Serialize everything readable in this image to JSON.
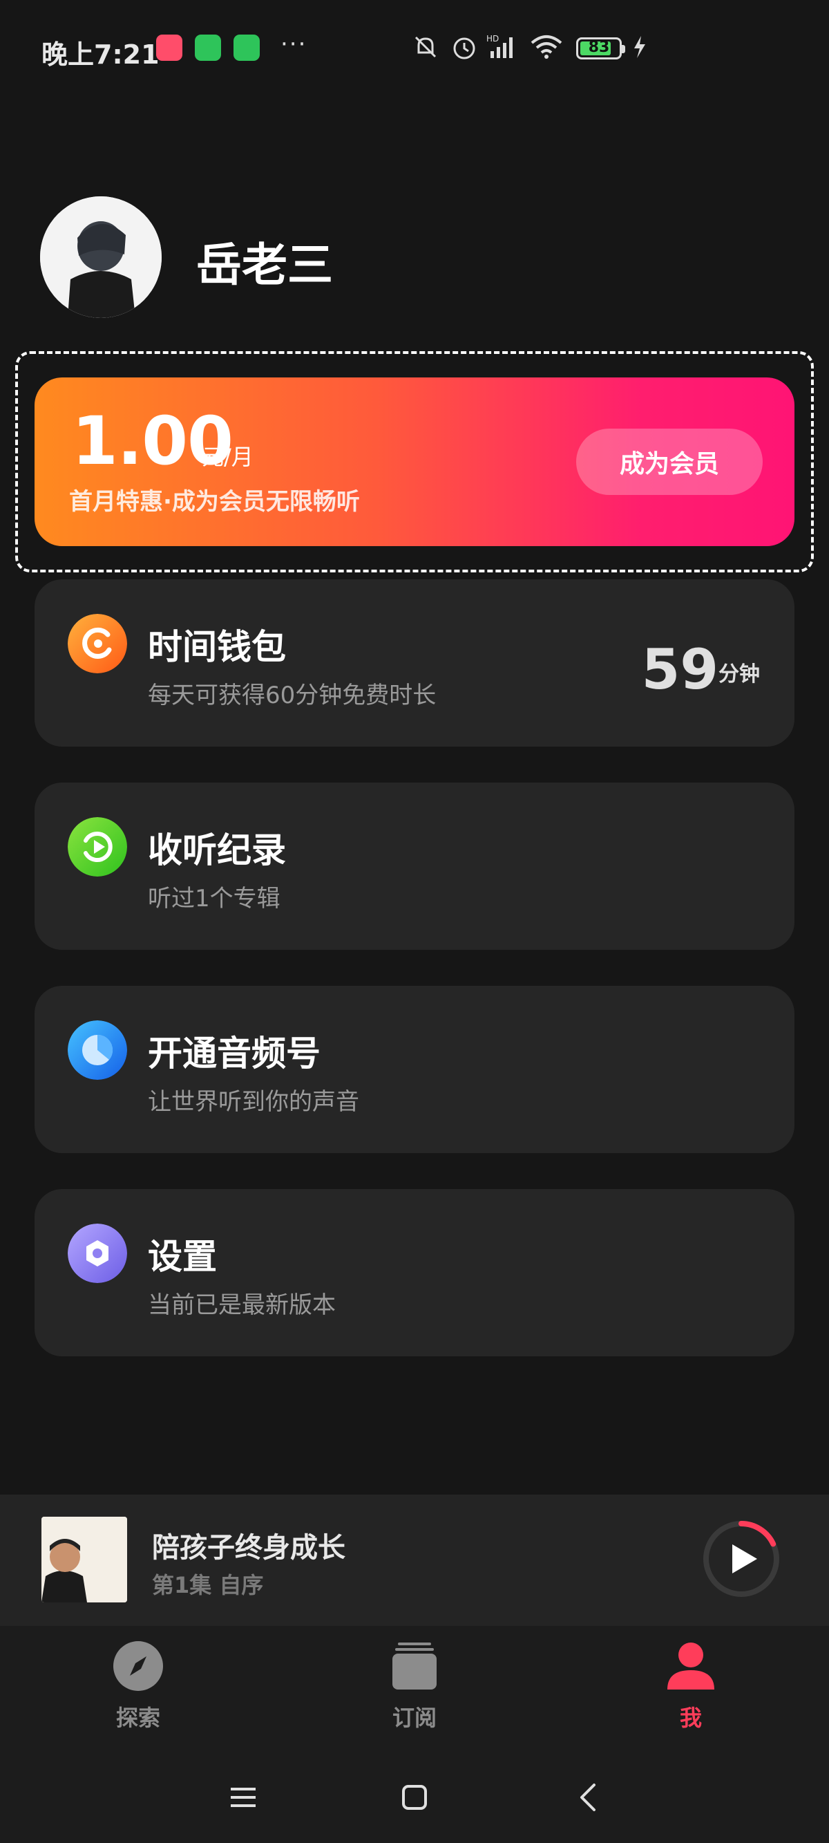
{
  "status_bar": {
    "time": "晚上7:21",
    "battery": "83",
    "battery_level": 0.83,
    "more": "···",
    "icons": [
      "app-notification-icon",
      "wechat-icon",
      "wechat-icon",
      "mute-icon",
      "alarm-icon",
      "signal-hd-icon",
      "wifi-icon",
      "battery-icon",
      "charging-icon"
    ]
  },
  "profile": {
    "username": "岳老三",
    "avatar_icon": "avatar-image"
  },
  "vip": {
    "price": "1.00",
    "unit": "元/月",
    "desc": "首月特惠·成为会员无限畅听",
    "button": "成为会员"
  },
  "menu": [
    {
      "title": "时间钱包",
      "subtitle": "每天可获得60分钟免费时长",
      "value": "59",
      "value_unit": "分钟",
      "icon": "time-wallet-icon",
      "color": "#ff8a1a"
    },
    {
      "title": "收听纪录",
      "subtitle": "听过1个专辑",
      "icon": "history-icon",
      "color": "#5fd42a"
    },
    {
      "title": "开通音频号",
      "subtitle": "让世界听到你的声音",
      "icon": "audio-channel-icon",
      "color": "#1c8cf2"
    },
    {
      "title": "设置",
      "subtitle": "当前已是最新版本",
      "icon": "settings-icon",
      "color": "#8a7cf0"
    }
  ],
  "player": {
    "title": "陪孩子终身成长",
    "subtitle": "第1集 自序",
    "cover_text": "陪孩子终身成长",
    "progress": 0.18
  },
  "tabs": [
    {
      "label": "探索",
      "icon": "compass-icon",
      "active": false
    },
    {
      "label": "订阅",
      "icon": "subscribe-icon",
      "active": false
    },
    {
      "label": "我",
      "icon": "user-icon",
      "active": true
    }
  ],
  "nav": [
    "menu-icon",
    "home-icon",
    "back-icon"
  ],
  "colors": {
    "accent": "#ff3d5a",
    "background": "#161616",
    "card": "#262626"
  }
}
